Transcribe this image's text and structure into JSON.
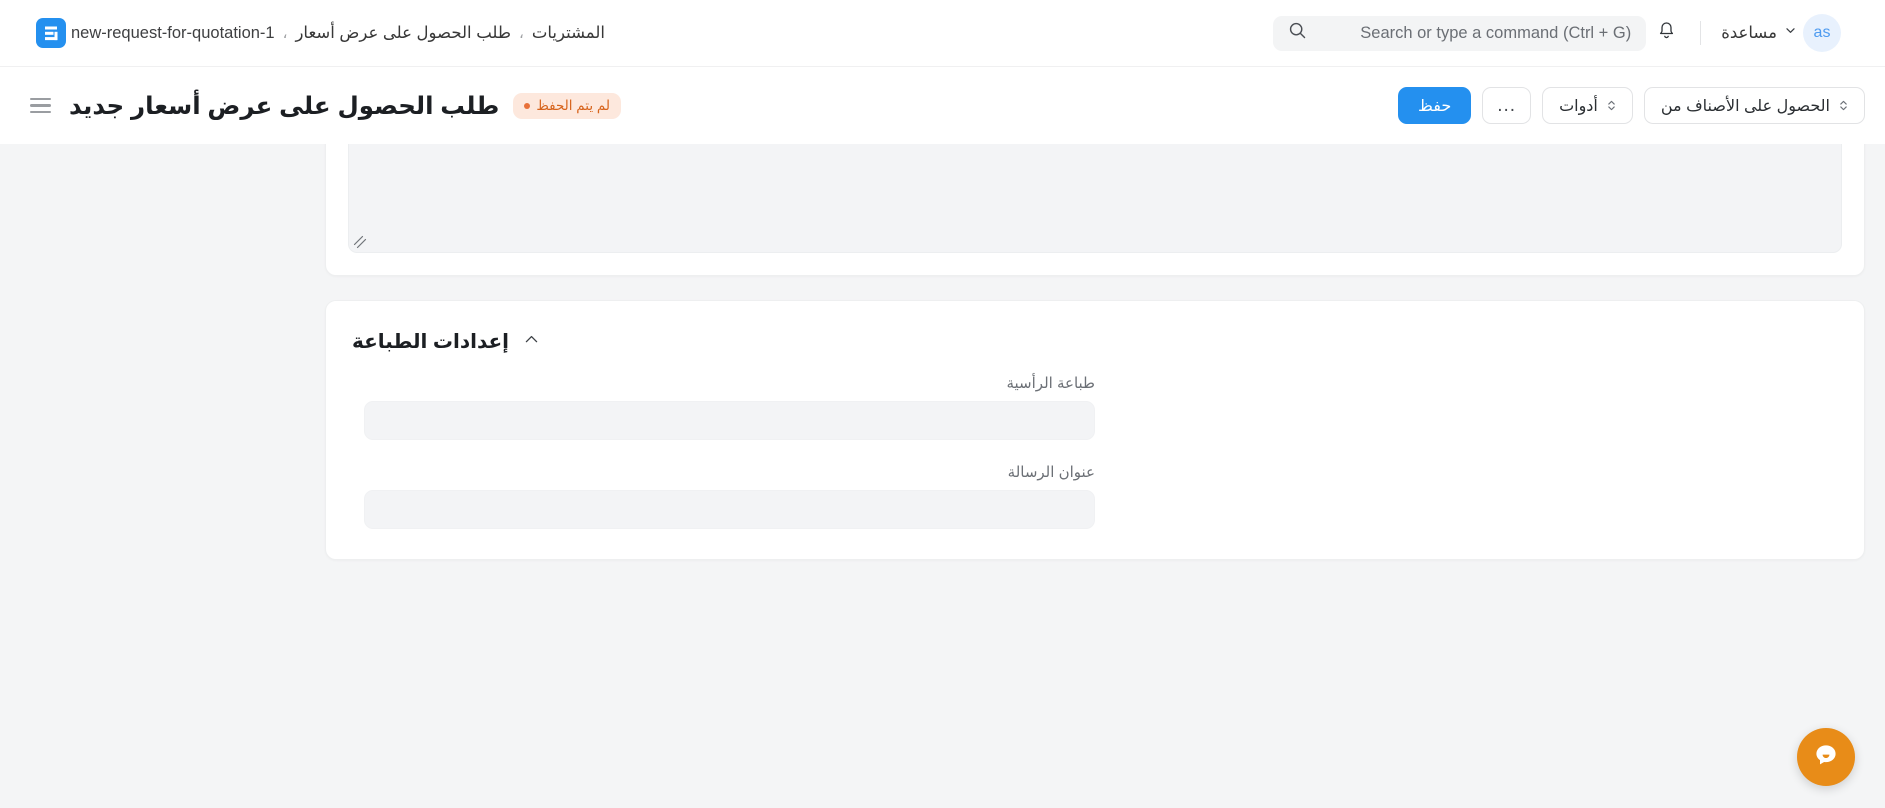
{
  "navbar": {
    "logo_icon": "erpnext-logo-icon",
    "breadcrumbs": [
      {
        "label": "المشتريات",
        "kind": "arabic"
      },
      {
        "label": "طلب الحصول على عرض أسعار",
        "kind": "arabic"
      },
      {
        "label": "new-request-for-quotation-1",
        "kind": "latin"
      }
    ],
    "separator": "،",
    "search": {
      "placeholder": "Search or type a command (Ctrl + G)",
      "value": "",
      "icon": "search-icon"
    },
    "notifications_icon": "bell-icon",
    "help": {
      "label": "مساعدة",
      "chevron_icon": "chevron-down-icon"
    },
    "avatar": {
      "initials": "as"
    }
  },
  "page_head": {
    "menu_icon": "hamburger-menu-icon",
    "title": "طلب الحصول على عرض أسعار جديد",
    "status_badge": {
      "label": "لم يتم الحفظ",
      "dot_color": "#e8713a",
      "bg_color": "#fde8dd",
      "text_color": "#d7641c"
    },
    "actions": {
      "save_label": "حفظ",
      "more_label": "...",
      "tools_label": "أدوات",
      "get_items_from_label": "الحصول على الأصناف من",
      "select_chevron_icon": "chevron-up-down-icon"
    }
  },
  "main": {
    "textarea_card": {
      "textarea_value": "",
      "resize_grip_icon": "resize-grip-icon"
    },
    "print_settings": {
      "section_title": "إعدادات الطباعة",
      "collapse_icon": "chevron-up-icon",
      "fields": [
        {
          "label": "طباعة الرأسية",
          "value": "",
          "placeholder": ""
        },
        {
          "label": "عنوان الرسالة",
          "value": "",
          "placeholder": ""
        }
      ]
    }
  },
  "chat_widget": {
    "icon": "chat-bubble-icon",
    "color": "#e88c18"
  },
  "theme": {
    "accent": "#2490ef",
    "page_bg": "#f4f5f6",
    "card_bg": "#ffffff",
    "control_bg": "#f3f4f6"
  }
}
